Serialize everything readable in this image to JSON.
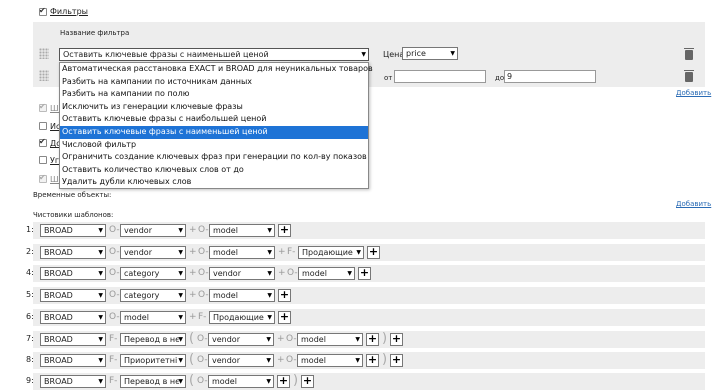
{
  "filters": {
    "checkbox_label": "Фильтры",
    "name_header": "Название фильтра",
    "row1": {
      "filter_value": "Оставить ключевые фразы с наименьшей ценой",
      "param_label": "Цена",
      "param_value": "price"
    },
    "row2": {
      "from_label": "от",
      "to_label": "до",
      "to_value": "9"
    },
    "add_link": "Добавить",
    "dropdown_options": [
      "Автоматическая расстановка EXACT и BROAD для неуникальных товаров",
      "Разбить на кампании по источникам данных",
      "Разбить на кампании по полю",
      "Исключить из генерации ключевые фразы",
      "Оставить ключевые фразы с наибольшей ценой",
      "Оставить ключевые фразы с наименьшей ценой",
      "Числовой фильтр",
      "Ограничить создание ключевых фраз при генерации по кол-ву показов",
      "Оставить количество ключевых слов от до",
      "Удалить дубли ключевых слов"
    ],
    "selected_option_index": 5,
    "partial_labels": [
      "Ша",
      "Ис",
      "До",
      "Уг",
      "Ша"
    ]
  },
  "temporary": {
    "label": "Временные объекты:",
    "add_link": "Добавить"
  },
  "templates": {
    "label": "Чистовики шаблонов:",
    "rows": [
      {
        "num": "1:",
        "items": [
          {
            "t": "sel",
            "v": "BROAD",
            "w": 66
          },
          {
            "t": "op",
            "v": "O"
          },
          {
            "t": "sel",
            "v": "vendor",
            "w": 66
          },
          {
            "t": "op",
            "v": "+"
          },
          {
            "t": "op",
            "v": "O"
          },
          {
            "t": "sel",
            "v": "model",
            "w": 66
          },
          {
            "t": "plus"
          }
        ]
      },
      {
        "num": "2:",
        "items": [
          {
            "t": "sel",
            "v": "BROAD",
            "w": 66
          },
          {
            "t": "op",
            "v": "O"
          },
          {
            "t": "sel",
            "v": "vendor",
            "w": 66
          },
          {
            "t": "op",
            "v": "+"
          },
          {
            "t": "op",
            "v": "O"
          },
          {
            "t": "sel",
            "v": "model",
            "w": 66
          },
          {
            "t": "op",
            "v": "+"
          },
          {
            "t": "op",
            "v": "F"
          },
          {
            "t": "sel",
            "v": "Продающие",
            "w": 66
          },
          {
            "t": "plus"
          }
        ]
      },
      {
        "num": "4:",
        "items": [
          {
            "t": "sel",
            "v": "BROAD",
            "w": 66
          },
          {
            "t": "op",
            "v": "O"
          },
          {
            "t": "sel",
            "v": "category",
            "w": 66
          },
          {
            "t": "op",
            "v": "+"
          },
          {
            "t": "op",
            "v": "O"
          },
          {
            "t": "sel",
            "v": "vendor",
            "w": 66
          },
          {
            "t": "op",
            "v": "+"
          },
          {
            "t": "op",
            "v": "O"
          },
          {
            "t": "sel",
            "v": "model",
            "w": 57
          },
          {
            "t": "plus"
          }
        ]
      },
      {
        "num": "5:",
        "items": [
          {
            "t": "sel",
            "v": "BROAD",
            "w": 66
          },
          {
            "t": "op",
            "v": "O"
          },
          {
            "t": "sel",
            "v": "category",
            "w": 66
          },
          {
            "t": "op",
            "v": "+"
          },
          {
            "t": "op",
            "v": "O"
          },
          {
            "t": "sel",
            "v": "model",
            "w": 66
          },
          {
            "t": "plus"
          }
        ]
      },
      {
        "num": "6:",
        "items": [
          {
            "t": "sel",
            "v": "BROAD",
            "w": 66
          },
          {
            "t": "op",
            "v": "O"
          },
          {
            "t": "sel",
            "v": "model",
            "w": 66
          },
          {
            "t": "op",
            "v": "+"
          },
          {
            "t": "op",
            "v": "F"
          },
          {
            "t": "sel",
            "v": "Продающие",
            "w": 66
          },
          {
            "t": "plus"
          }
        ]
      },
      {
        "num": "7:",
        "items": [
          {
            "t": "sel",
            "v": "BROAD",
            "w": 66
          },
          {
            "t": "op",
            "v": "F"
          },
          {
            "t": "sel",
            "v": "Перевод в нє",
            "w": 66
          },
          {
            "t": "paren",
            "v": "("
          },
          {
            "t": "op",
            "v": "O"
          },
          {
            "t": "sel",
            "v": "vendor",
            "w": 66
          },
          {
            "t": "op",
            "v": "+"
          },
          {
            "t": "op",
            "v": "O"
          },
          {
            "t": "sel",
            "v": "model",
            "w": 66
          },
          {
            "t": "plus"
          },
          {
            "t": "paren",
            "v": ")"
          },
          {
            "t": "plus"
          }
        ]
      },
      {
        "num": "8:",
        "items": [
          {
            "t": "sel",
            "v": "BROAD",
            "w": 66
          },
          {
            "t": "op",
            "v": "F"
          },
          {
            "t": "sel",
            "v": "Приоритетні",
            "w": 66
          },
          {
            "t": "paren",
            "v": "("
          },
          {
            "t": "op",
            "v": "O"
          },
          {
            "t": "sel",
            "v": "vendor",
            "w": 66
          },
          {
            "t": "op",
            "v": "+"
          },
          {
            "t": "op",
            "v": "O"
          },
          {
            "t": "sel",
            "v": "model",
            "w": 66
          },
          {
            "t": "plus"
          },
          {
            "t": "paren",
            "v": ")"
          },
          {
            "t": "plus"
          }
        ]
      },
      {
        "num": "9:",
        "items": [
          {
            "t": "sel",
            "v": "BROAD",
            "w": 66
          },
          {
            "t": "op",
            "v": "F"
          },
          {
            "t": "sel",
            "v": "Перевод в нє",
            "w": 66
          },
          {
            "t": "paren",
            "v": "("
          },
          {
            "t": "op",
            "v": "O"
          },
          {
            "t": "sel",
            "v": "model",
            "w": 66
          },
          {
            "t": "plus"
          },
          {
            "t": "paren",
            "v": ")"
          },
          {
            "t": "plus"
          }
        ]
      }
    ]
  }
}
